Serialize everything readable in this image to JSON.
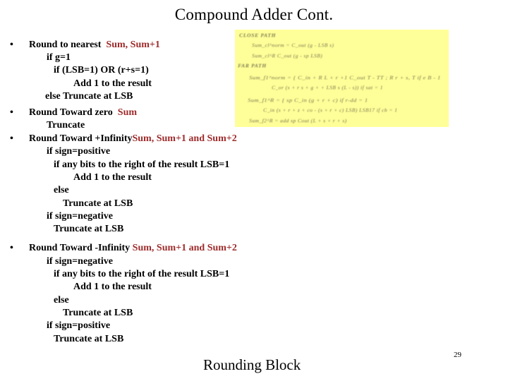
{
  "slide": {
    "title": "Compound Adder Cont.",
    "caption": "Rounding Block",
    "page_number": "29",
    "accent_color": "#9e2b2b",
    "panel_color": "#ffff99",
    "background_color": "#ffffff"
  },
  "bullets": [
    {
      "marker": "•",
      "label": "Round to nearest",
      "accent": "Sum, Sum+1",
      "lines": [
        "if g=1",
        "if (LSB=1) OR (r+s=1)",
        "Add 1 to the result",
        "else Truncate at LSB"
      ]
    },
    {
      "marker": "•",
      "label": "Round Toward zero",
      "accent": "Sum",
      "lines": [
        "Truncate"
      ]
    },
    {
      "marker": "•",
      "label": "Round Toward +Infinity",
      "accent": "Sum, Sum+1 and Sum+2",
      "lines": [
        "if sign=positive",
        "if any bits to the right of the result LSB=1",
        "Add 1 to the result",
        "else",
        "Truncate at LSB",
        "if sign=negative",
        "Truncate at LSB"
      ]
    },
    {
      "marker": "•",
      "label": "Round Toward -Infinity",
      "accent": "Sum, Sum+1 and Sum+2",
      "lines": [
        "if sign=negative",
        "if any bits to the right of the result LSB=1",
        "Add 1 to the result",
        "else",
        "Truncate at LSB",
        "if sign=positive",
        "Truncate at LSB"
      ]
    }
  ],
  "formula_panel": {
    "description": "scanned-equation-image",
    "lines": [
      "CLOSE PATH",
      "Sum_cl^norm = C_out (g - LSB s)",
      "Sum_cl^R  C_out (g - sp  LSB)",
      "FAR PATH",
      "Sum_f1^norm = { C_in + R  L + r  +1 C_out  T - TT   ;  R  r + s, T  if e B - 1",
      "C_or  (s  + r  s + g + + LSB  s  (L - s))              if sat = 1",
      "Sum_f1^R = { sp  C_in  (g + r + c)                        if r-dd = 1",
      "C_in  (s + r + z + co - (s + r + c)  LSB)  LSB17  if cb = 1",
      "Sum_f2^R = add  sp  Cout (L + s + r + s)"
    ]
  }
}
